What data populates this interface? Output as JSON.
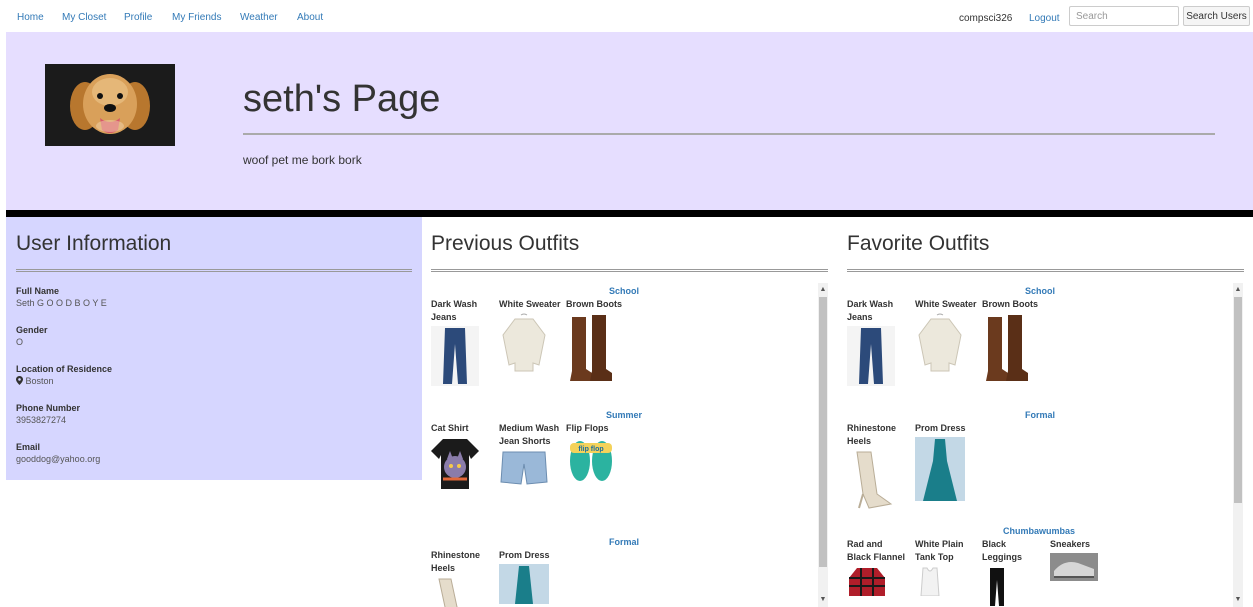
{
  "nav": {
    "links": [
      "Home",
      "My Closet",
      "Profile",
      "My Friends",
      "Weather",
      "About"
    ],
    "username": "compsci326",
    "logout": "Logout",
    "search_placeholder": "Search",
    "search_button": "Search Users"
  },
  "header": {
    "title": "seth's Page",
    "tagline": "woof pet me bork bork"
  },
  "user_info": {
    "heading": "User Information",
    "fields": [
      {
        "label": "Full Name",
        "value": "Seth G O O D B O Y E"
      },
      {
        "label": "Gender",
        "value": "O"
      },
      {
        "label": "Location of Residence",
        "value": "Boston",
        "icon": "map-marker-icon"
      },
      {
        "label": "Phone Number",
        "value": "3953827274"
      },
      {
        "label": "Email",
        "value": "gooddog@yahoo.org"
      }
    ]
  },
  "previous": {
    "heading": "Previous Outfits",
    "groups": [
      {
        "name": "School",
        "items": [
          "Dark Wash Jeans",
          "White Sweater",
          "Brown Boots"
        ]
      },
      {
        "name": "Summer",
        "items": [
          "Cat Shirt",
          "Medium Wash Jean Shorts",
          "Flip Flops"
        ]
      },
      {
        "name": "Formal",
        "items": [
          "Rhinestone Heels",
          "Prom Dress"
        ]
      }
    ]
  },
  "favorite": {
    "heading": "Favorite Outfits",
    "groups": [
      {
        "name": "School",
        "items": [
          "Dark Wash Jeans",
          "White Sweater",
          "Brown Boots"
        ]
      },
      {
        "name": "Formal",
        "items": [
          "Rhinestone Heels",
          "Prom Dress"
        ]
      },
      {
        "name": "Chumbawumbas",
        "items": [
          "Rad and Black Flannel",
          "White Plain Tank Top",
          "Black Leggings",
          "Sneakers"
        ]
      }
    ]
  },
  "flipflop_text": "flip flop",
  "colors": {
    "header_bg": "#e6deff",
    "userinfo_bg": "#d6d6ff",
    "link": "#337ab7"
  }
}
